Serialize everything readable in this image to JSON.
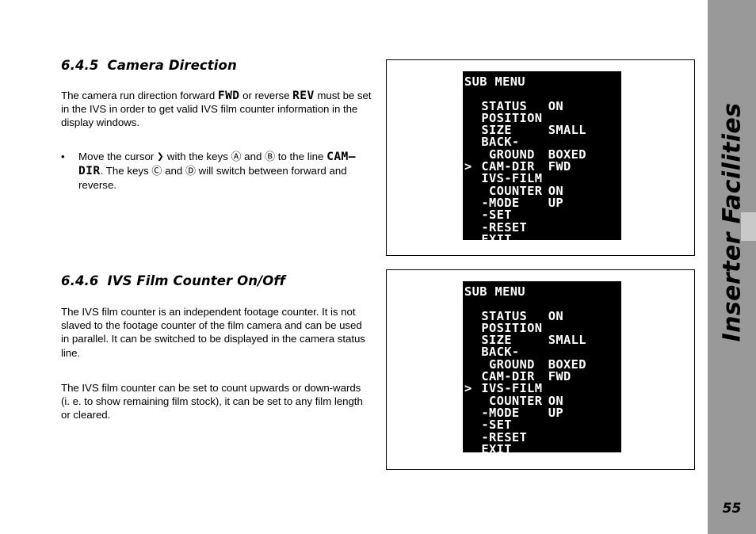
{
  "sidebar": {
    "title": "Inserter Facilities",
    "page_number": "55",
    "bg_color": "#999999",
    "tab_color": "#c9c9c9"
  },
  "sections": [
    {
      "number": "6.4.5",
      "title": "Camera Direction",
      "paragraph": {
        "part1": "The camera run direction forward ",
        "mono1": "FWD",
        "part2": " or reverse ",
        "mono2": "REV",
        "part3": " must be set in the IVS in order to get valid IVS film counter information in the display windows."
      },
      "bullet": {
        "marker": "•",
        "part1": "Move the cursor ",
        "cursor_glyph": "❯",
        "part2": " with the keys ",
        "key_up": "Ⓐ",
        "part3": " and ",
        "key_down": "Ⓑ",
        "part4": " to the line ",
        "mono1": "CAM–DIR",
        "part5": ". The keys ",
        "key_right": "Ⓒ",
        "part6": " and ",
        "key_left": "Ⓓ",
        "part7": " will switch between forward and reverse."
      }
    },
    {
      "number": "6.4.6",
      "title": "IVS Film Counter On/Off",
      "paragraph1": "The IVS film counter is an independent footage counter. It is not slaved to the footage counter of the film camera and can be used in parallel. It can be switched to be displayed in the camera status line.",
      "paragraph2": "The IVS film counter can be set to count upwards or down-wards (i. e. to show remaining film stock), it can be set to any film length or cleared."
    }
  ],
  "figures": [
    {
      "name": "sub-menu-cam-dir-selected",
      "lcd": {
        "title": "SUB MENU",
        "cursor_symbol": ">",
        "cursor_on_row": 5,
        "rows": [
          {
            "label": "STATUS",
            "value": "ON",
            "indent": 0
          },
          {
            "label": "POSITION",
            "value": "",
            "indent": 0
          },
          {
            "label": "SIZE",
            "value": "SMALL",
            "indent": 0
          },
          {
            "label": "BACK-",
            "value": "",
            "indent": 0
          },
          {
            "label": "GROUND",
            "value": "BOXED",
            "indent": 1
          },
          {
            "label": "CAM-DIR",
            "value": "FWD",
            "indent": 0
          },
          {
            "label": "IVS-FILM",
            "value": "",
            "indent": 0
          },
          {
            "label": "COUNTER",
            "value": "ON",
            "indent": 1
          },
          {
            "label": "-MODE",
            "value": "UP",
            "indent": 0
          },
          {
            "label": "-SET",
            "value": "",
            "indent": 0
          },
          {
            "label": "-RESET",
            "value": "",
            "indent": 0
          },
          {
            "label": "EXIT",
            "value": "",
            "indent": 0
          }
        ]
      }
    },
    {
      "name": "sub-menu-ivs-film-selected",
      "lcd": {
        "title": "SUB MENU",
        "cursor_symbol": ">",
        "cursor_on_row": 6,
        "rows": [
          {
            "label": "STATUS",
            "value": "ON",
            "indent": 0
          },
          {
            "label": "POSITION",
            "value": "",
            "indent": 0
          },
          {
            "label": "SIZE",
            "value": "SMALL",
            "indent": 0
          },
          {
            "label": "BACK-",
            "value": "",
            "indent": 0
          },
          {
            "label": "GROUND",
            "value": "BOXED",
            "indent": 1
          },
          {
            "label": "CAM-DIR",
            "value": "FWD",
            "indent": 0
          },
          {
            "label": "IVS-FILM",
            "value": "",
            "indent": 0
          },
          {
            "label": "COUNTER",
            "value": "ON",
            "indent": 1
          },
          {
            "label": "-MODE",
            "value": "UP",
            "indent": 0
          },
          {
            "label": "-SET",
            "value": "",
            "indent": 0
          },
          {
            "label": "-RESET",
            "value": "",
            "indent": 0
          },
          {
            "label": "EXIT",
            "value": "",
            "indent": 0
          }
        ]
      }
    }
  ]
}
